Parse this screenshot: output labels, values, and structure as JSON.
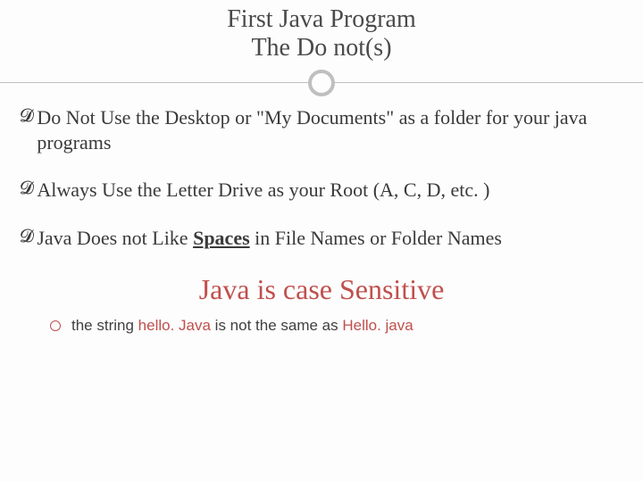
{
  "title": {
    "line1": "First Java Program",
    "line2": "The Do not(s)"
  },
  "bullets": [
    {
      "text_pre": "Do Not Use the Desktop or \"My Documents\" as a folder for your java programs"
    },
    {
      "text_pre": "Always Use the Letter Drive as your Root (A, C, D, etc. )"
    },
    {
      "text_pre": "Java Does not Like ",
      "emph": "Spaces",
      "text_post": " in File Names or Folder Names"
    }
  ],
  "callout": "Java is case Sensitive",
  "sub": {
    "pre": "the string ",
    "a": "hello. Java",
    "mid": " is not the same as ",
    "b": "Hello. java"
  },
  "colors": {
    "accent": "#c0504d",
    "text": "#3a3a3a",
    "divider": "#bfbfbf"
  }
}
